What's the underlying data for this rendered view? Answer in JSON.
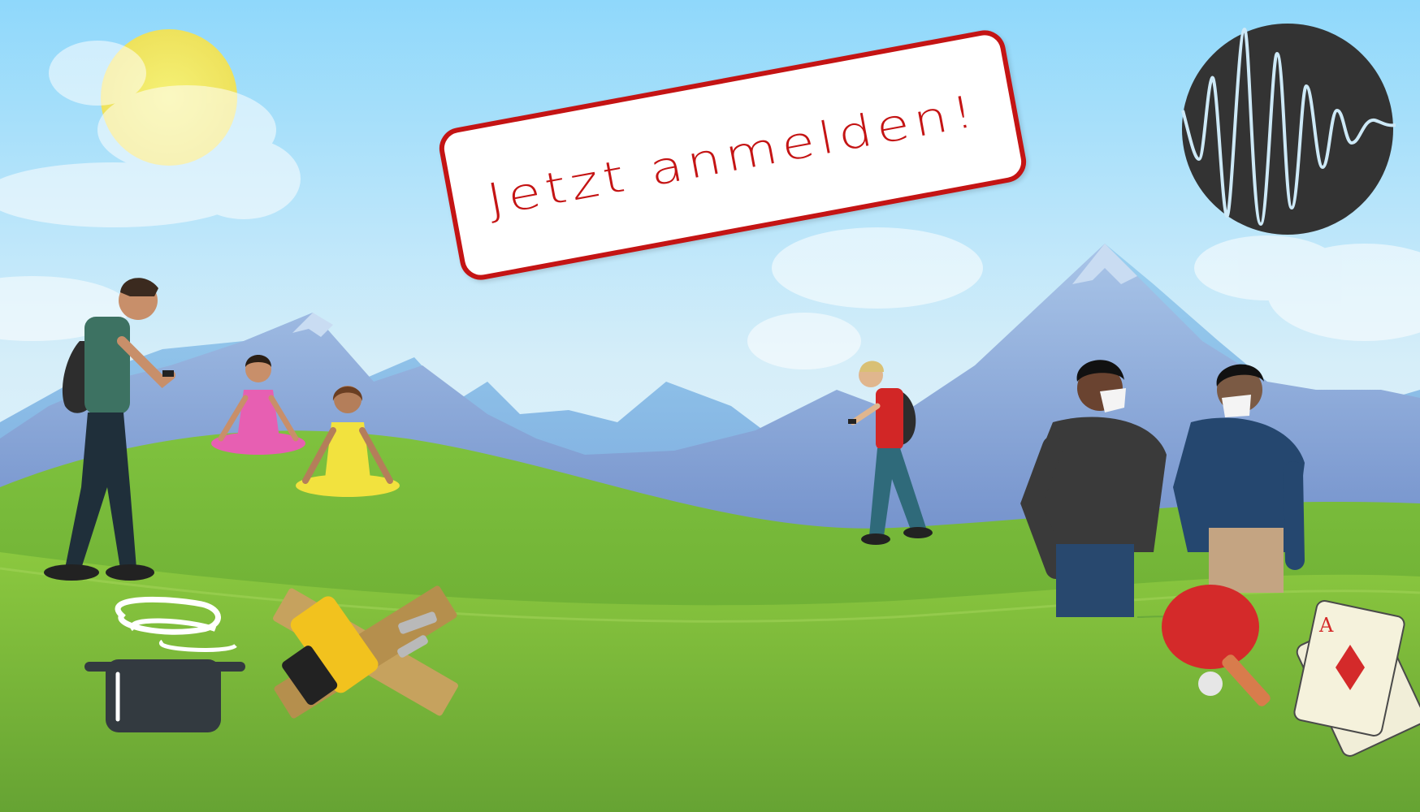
{
  "banner": {
    "cta_label": "Jetzt anmelden!"
  },
  "colors": {
    "sky_top": "#8fd8fb",
    "sky_bottom": "#e9f6fd",
    "mountain": "#8aa9d8",
    "grass": "#7cc23a",
    "cta_red": "#c41414",
    "logo_dark": "#333333",
    "logo_wave": "#cde9f7"
  },
  "icons": [
    "sun-icon",
    "wave-logo-icon",
    "cooking-pot-icon",
    "drill-wood-icon",
    "ping-pong-paddle-icon",
    "playing-cards-icon"
  ]
}
